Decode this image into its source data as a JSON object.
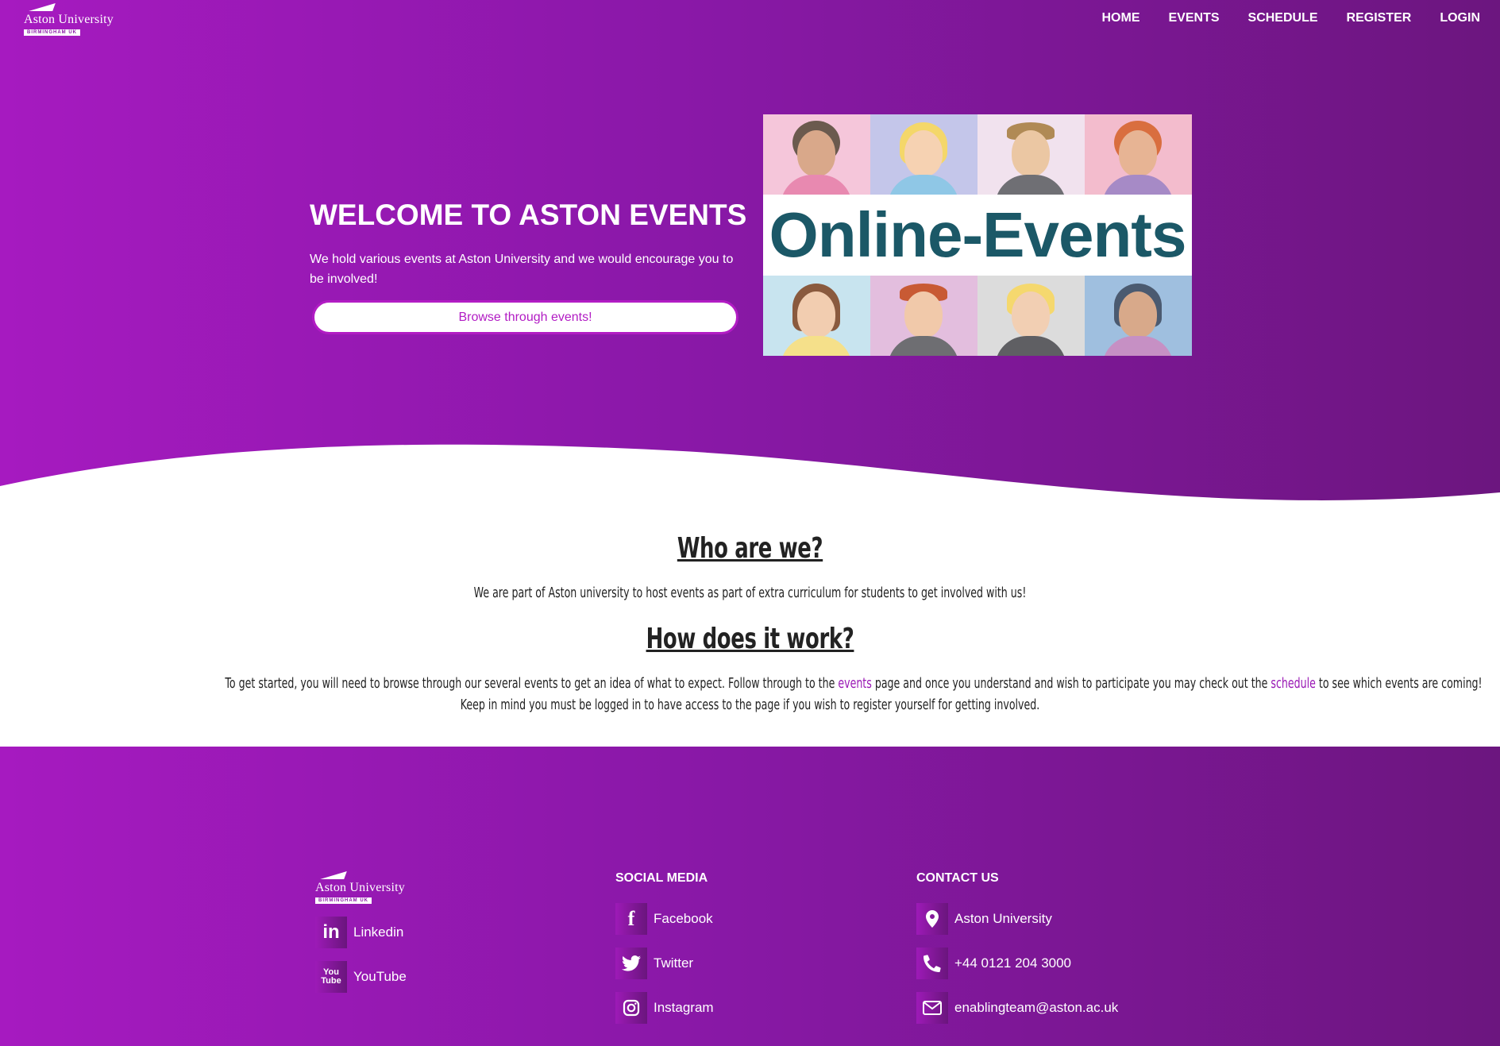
{
  "header": {
    "logo": {
      "name": "Aston University",
      "sub": "BIRMINGHAM UK"
    },
    "nav": [
      "HOME",
      "EVENTS",
      "SCHEDULE",
      "REGISTER",
      "LOGIN"
    ]
  },
  "hero": {
    "title": "WELCOME TO ASTON EVENTS",
    "text": "We hold various events at Aston University and we would encourage you to be involved!",
    "button": "Browse through events!",
    "image_text": "Online-Events"
  },
  "about": {
    "who_title": "Who are we?",
    "who_text": "We are part of Aston university to host events as part of extra curriculum for students to get involved with us!",
    "how_title": "How does it work?",
    "how_text_1a": "To get started, you will need to browse through our several events to get an idea of what to expect. Follow through to the ",
    "how_link_events": "events",
    "how_text_1b": " page and once you understand and wish to participate you may check out the ",
    "how_link_schedule": "schedule",
    "how_text_1c": " to see which events are coming!",
    "how_text_2": "Keep in mind you must be logged in to have access to the page if you wish to register yourself for getting involved."
  },
  "footer": {
    "logo": {
      "name": "Aston University",
      "sub": "BIRMINGHAM UK"
    },
    "links": [
      {
        "label": "Linkedin",
        "icon": "linkedin-icon"
      },
      {
        "label": "YouTube",
        "icon": "youtube-icon"
      }
    ],
    "social_title": "SOCIAL MEDIA",
    "social": [
      {
        "label": "Facebook",
        "icon": "facebook-icon"
      },
      {
        "label": "Twitter",
        "icon": "twitter-icon"
      },
      {
        "label": "Instagram",
        "icon": "instagram-icon"
      }
    ],
    "contact_title": "CONTACT US",
    "contact": [
      {
        "label": "Aston University",
        "icon": "location-icon"
      },
      {
        "label": "+44 0121 204 3000",
        "icon": "phone-icon"
      },
      {
        "label": "enablingteam@aston.ac.uk",
        "icon": "mail-icon"
      }
    ]
  },
  "colors": {
    "primary": "#a61ac0",
    "dark": "#6c167f",
    "accent_text": "#b21cc4",
    "image_text": "#1b5867"
  }
}
